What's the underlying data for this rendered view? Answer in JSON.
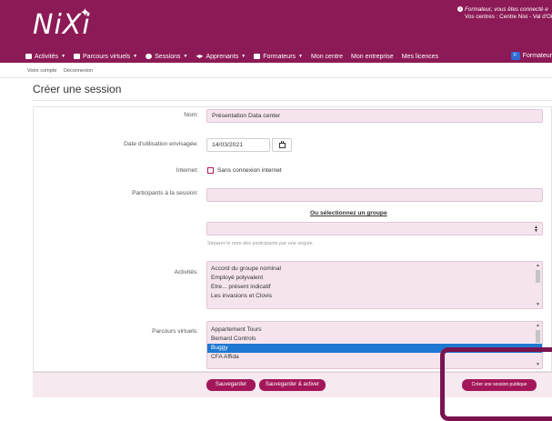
{
  "header": {
    "logo": "NiXi",
    "notice_line1": "Formateur, vous êtes connecté e",
    "notice_line2": "Vos centres : Centre Nixi - Val d'Ois"
  },
  "nav": {
    "items": [
      {
        "label": "Activités",
        "caret": "▼"
      },
      {
        "label": "Parcours virtuels",
        "caret": "▼"
      },
      {
        "label": "Sessions",
        "caret": "▼"
      },
      {
        "label": "Apprenants",
        "caret": "▼"
      },
      {
        "label": "Formateurs",
        "caret": "▼"
      },
      {
        "label": "Mon centre"
      },
      {
        "label": "Mon entreprise"
      },
      {
        "label": "Mes licences"
      }
    ],
    "user_badge": "F",
    "user_label": "Formateur"
  },
  "account": {
    "votre_compte": "Votre compte",
    "deconnexion": "Déconnexion"
  },
  "page": {
    "title": "Créer une session"
  },
  "form": {
    "nom_label": "Nom:",
    "nom_value": "Présentation Data center",
    "date_label": "Date d'utilisation envisagée:",
    "date_value": "14/03/2021",
    "internet_label": "Internet:",
    "internet_option": "Sans connexion internet",
    "participants_label": "Participants à la session:",
    "participants_value": "",
    "group_link": "Ou sélectionnez un groupe",
    "group_select_value": "",
    "participants_help": "Séparer le nom des participants par une virgule.",
    "activites_label": "Activités:",
    "activites": [
      "Accord du groupe nominal",
      "Employé polyvalent",
      "Etre... présent indicatif",
      "Les invasions et Clovis"
    ],
    "parcours_label": "Parcours virtuels:",
    "parcours": [
      "Appartement Tours",
      "Bemard Controls",
      "Buggy",
      "CFA Affida"
    ],
    "parcours_selected": "Buggy"
  },
  "buttons": {
    "save": "Sauvegarder",
    "save_activate": "Sauvegarder & activer",
    "public_session": "Créer une session publique"
  },
  "colors": {
    "brand": "#8c1a56",
    "accent": "#a3175a",
    "selection": "#1f78d1"
  }
}
